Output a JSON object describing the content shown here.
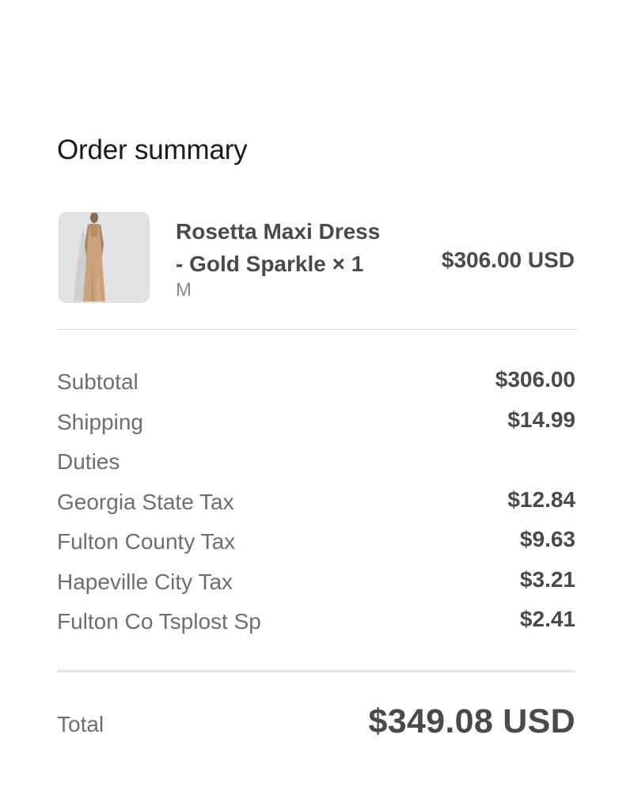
{
  "summary": {
    "title": "Order summary"
  },
  "item": {
    "name_line1": "Rosetta Maxi Dress",
    "name_line2": "- Gold Sparkle × 1",
    "variant": "M",
    "price": "$306.00 USD",
    "image_icon": "dress-product-image"
  },
  "lines": [
    {
      "label": "Subtotal",
      "amount": "$306.00"
    },
    {
      "label": "Shipping",
      "amount": "$14.99"
    },
    {
      "label": "Duties",
      "amount": ""
    },
    {
      "label": "Georgia State Tax",
      "amount": "$12.84"
    },
    {
      "label": "Fulton County Tax",
      "amount": "$9.63"
    },
    {
      "label": "Hapeville City Tax",
      "amount": "$3.21"
    },
    {
      "label": "Fulton Co Tsplost Sp",
      "amount": "$2.41"
    }
  ],
  "total": {
    "label": "Total",
    "amount": "$349.08 USD"
  },
  "colors": {
    "text_dark": "#1a1a1a",
    "text_body": "#4a4a4a",
    "text_muted": "#6e6e6e",
    "divider": "#dedede"
  }
}
